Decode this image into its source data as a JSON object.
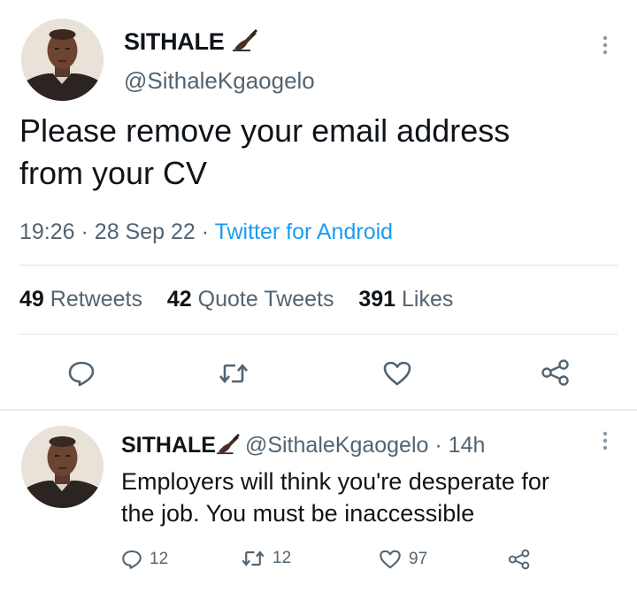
{
  "tweet": {
    "display_name": "SITHALE",
    "handle": "@SithaleKgaogelo",
    "text_line1": "Please remove your email address",
    "text_line2": "from your CV",
    "time": "19:26",
    "date": "28 Sep 22",
    "source": "Twitter for Android",
    "retweets_count": "49",
    "retweets_label": "Retweets",
    "quotes_count": "42",
    "quotes_label": "Quote Tweets",
    "likes_count": "391",
    "likes_label": "Likes",
    "more_icon": "more-vertical-icon"
  },
  "reply": {
    "display_name": "SITHALE",
    "handle": "@SithaleKgaogelo",
    "age": "14h",
    "text_line1": "Employers will think you're desperate for",
    "text_line2": "the job. You must be inaccessible",
    "reply_count": "12",
    "retweet_count": "12",
    "like_count": "97"
  },
  "icons": {
    "reply": "reply-icon",
    "retweet": "retweet-icon",
    "like": "heart-icon",
    "share": "share-icon",
    "name_emoji": "writing-hand-icon"
  },
  "colors": {
    "text": "#0f1419",
    "secondary": "#536471",
    "link": "#1d9bf0",
    "divider": "#dfe3e7"
  }
}
